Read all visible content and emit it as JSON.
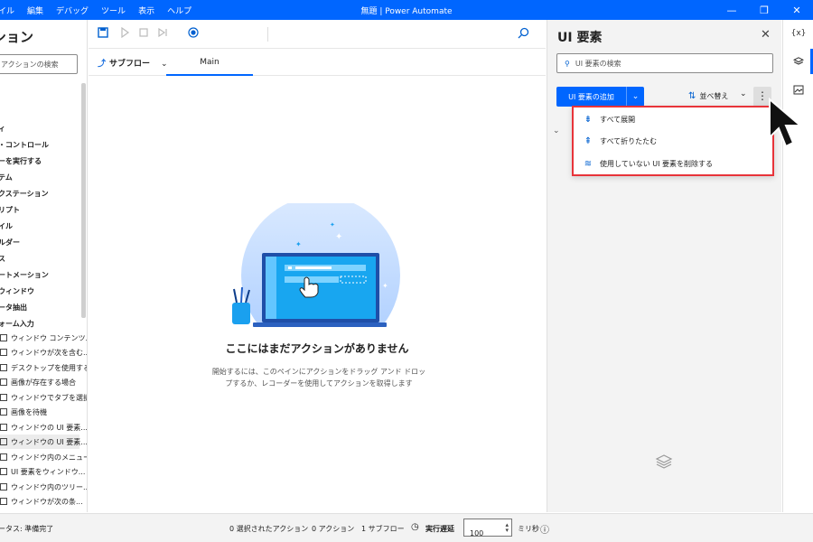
{
  "titlebar": {
    "menu": [
      "イル",
      "編集",
      "デバッグ",
      "ツール",
      "表示",
      "ヘルプ"
    ],
    "title": "無題 | Power Automate",
    "controls": [
      "—",
      "❐",
      "✕"
    ]
  },
  "actions_pane": {
    "title": "ション",
    "search_placeholder": "アクションの検索",
    "categories": [
      "ィ",
      "・コントロール",
      "ーを実行する",
      "テム",
      "クステーション",
      "リプト",
      "イル",
      "ルダー",
      "ス",
      "ートメーション",
      "ウィンドウ",
      "ータ抽出",
      "ォーム入力"
    ],
    "items": [
      "ウィンドウ コンテンツ...",
      "ウィンドウが次を含む...",
      "デスクトップを使用する",
      "画像が存在する場合",
      "ウィンドウでタブを選択",
      "画像を待機",
      "ウィンドウの UI 要素...",
      "ウィンドウの UI 要素...",
      "ウィンドウ内のメニュー...",
      "UI 要素をウィンドウ...",
      "ウィンドウ内のツリー...",
      "ウィンドウが次の条..."
    ]
  },
  "canvas": {
    "subflow_label": "サブフロー",
    "main_tab": "Main",
    "empty_title": "ここにはまだアクションがありません",
    "empty_desc": "開始するには、このペインにアクションをドラッグ アンド ドロップするか、レコーダーを使用してアクションを取得します"
  },
  "ui_elements_pane": {
    "title": "UI 要素",
    "search_placeholder": "UI 要素の検索",
    "add_button": "UI 要素の追加",
    "sort_label": "並べ替え",
    "menu": [
      {
        "label": "すべて展開",
        "icon": "expand-all-icon"
      },
      {
        "label": "すべて折りたたむ",
        "icon": "collapse-all-icon"
      },
      {
        "label": "使用していない UI 要素を削除する",
        "icon": "remove-unused-icon"
      }
    ]
  },
  "right_strip": {
    "variables_label": "{x}"
  },
  "statusbar": {
    "status": "ータス: 準備完了",
    "selected_actions": "0 選択されたアクション",
    "actions": "0 アクション",
    "subflows": "1 サブフロー",
    "delay_label": "実行遅延",
    "delay_value": "100",
    "unit": "ミリ秒",
    "info": "ⓘ"
  },
  "colors": {
    "accent": "#0066ff",
    "highlight_border": "#e8343a"
  }
}
